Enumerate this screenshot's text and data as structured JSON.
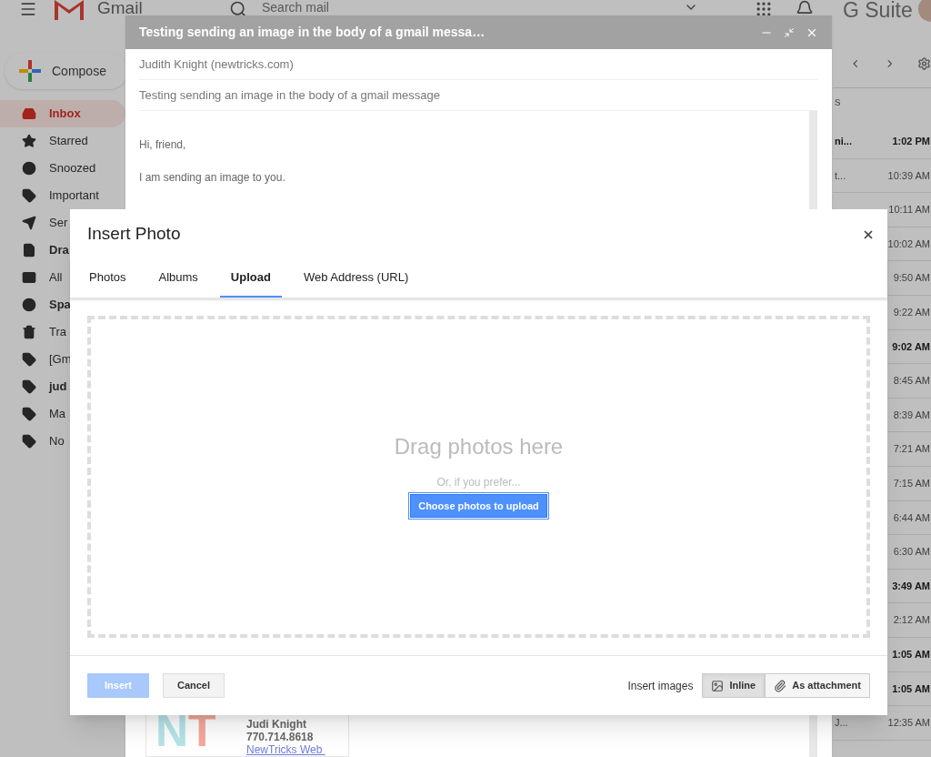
{
  "app_header": {
    "logo_text": "Gmail",
    "search_placeholder": "Search mail",
    "brand": "G Suite"
  },
  "sidebar": {
    "compose": "Compose",
    "items": [
      {
        "label": "Inbox",
        "selected": true,
        "unread": true
      },
      {
        "label": "Starred",
        "selected": false,
        "unread": false
      },
      {
        "label": "Snoozed",
        "selected": false,
        "unread": false
      },
      {
        "label": "Important",
        "selected": false,
        "unread": false
      },
      {
        "label": "Ser",
        "selected": false,
        "unread": false
      },
      {
        "label": "Dra",
        "selected": false,
        "unread": true
      },
      {
        "label": "All",
        "selected": false,
        "unread": false
      },
      {
        "label": "Spa",
        "selected": false,
        "unread": true
      },
      {
        "label": "Tra",
        "selected": false,
        "unread": false
      },
      {
        "label": "[Gm",
        "selected": false,
        "unread": false
      },
      {
        "label": "jud",
        "selected": false,
        "unread": true
      },
      {
        "label": "Ma",
        "selected": false,
        "unread": false
      },
      {
        "label": "No",
        "selected": false,
        "unread": false
      }
    ]
  },
  "mail_list": {
    "header_fragment": "s",
    "rows": [
      {
        "snippet": "ni...",
        "time": "1:02 PM",
        "unread": true
      },
      {
        "snippet": "t...",
        "time": "10:39 AM",
        "unread": false
      },
      {
        "time": "10:11 AM",
        "unread": false
      },
      {
        "time": "10:02 AM",
        "unread": false
      },
      {
        "time": "9:50 AM",
        "unread": false
      },
      {
        "time": "9:22 AM",
        "unread": false
      },
      {
        "time": "9:02 AM",
        "unread": true
      },
      {
        "time": "8:45 AM",
        "unread": false
      },
      {
        "time": "8:39 AM",
        "unread": false
      },
      {
        "time": "7:21 AM",
        "unread": false
      },
      {
        "time": "7:15 AM",
        "unread": false
      },
      {
        "time": "6:44 AM",
        "unread": false
      },
      {
        "time": "6:30 AM",
        "unread": false
      },
      {
        "time": "3:49 AM",
        "unread": true
      },
      {
        "time": "2:12 AM",
        "unread": false
      },
      {
        "time": "1:05 AM",
        "unread": true
      },
      {
        "time": "1:05 AM",
        "unread": true
      },
      {
        "snippet": "J...",
        "time": "12:35 AM",
        "unread": false
      }
    ]
  },
  "compose": {
    "title": "Testing sending an image in the body of a gmail messa…",
    "to": "Judith Knight (newtricks.com)",
    "subject": "Testing sending an image in the body of a gmail message",
    "body": [
      "Hi, friend,",
      "I am sending an image to you."
    ],
    "signature": {
      "logo": [
        {
          "letter": "N",
          "color": "#b5e4e8"
        },
        {
          "letter": "T",
          "color": "#f4a99b"
        }
      ],
      "name": "Judi Knight",
      "phone": "770.714.8618",
      "link": "NewTricks Web "
    }
  },
  "dialog": {
    "title": "Insert Photo",
    "tabs": [
      {
        "label": "Photos",
        "selected": false
      },
      {
        "label": "Albums",
        "selected": false
      },
      {
        "label": "Upload",
        "selected": true
      },
      {
        "label": "Web Address (URL)",
        "selected": false
      }
    ],
    "drop_title": "Drag photos here",
    "drop_hint": "Or, if you prefer...",
    "upload_button": "Choose photos to upload",
    "insert_button": {
      "label": "Insert",
      "disabled": true
    },
    "cancel_button": "Cancel",
    "insert_images_label": "Insert images",
    "insert_modes": [
      {
        "label": "Inline",
        "kind": "inline",
        "selected": true
      },
      {
        "label": "As attachment",
        "kind": "attachment",
        "selected": false
      }
    ]
  }
}
